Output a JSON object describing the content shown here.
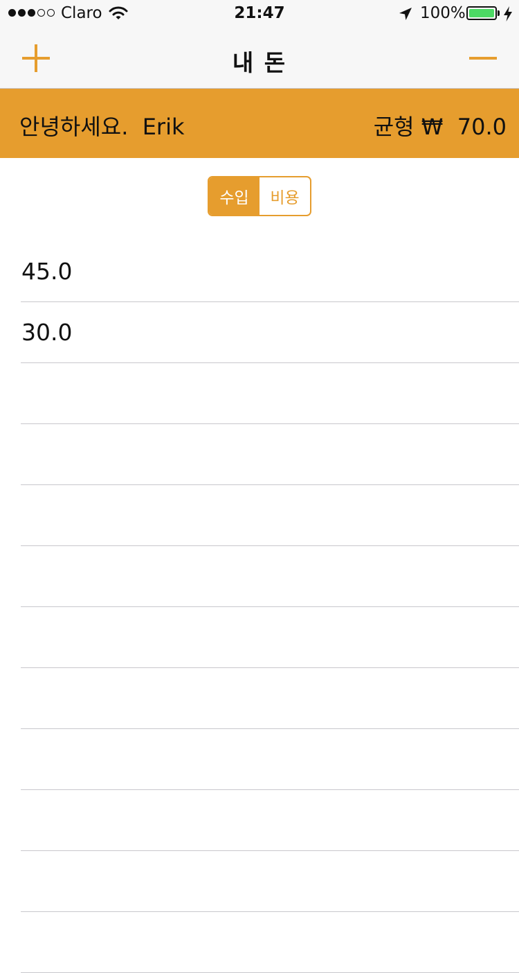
{
  "status_bar": {
    "signal_dots_filled": 3,
    "signal_dots_total": 5,
    "carrier": "Claro",
    "time": "21:47",
    "battery_percent_label": "100%",
    "battery_level": 1.0,
    "battery_color": "#4cd964",
    "icons": [
      "wifi-icon",
      "location-arrow-icon",
      "battery-icon",
      "charging-bolt-icon"
    ]
  },
  "nav": {
    "title": "내 돈",
    "left_icon": "plus-icon",
    "right_icon": "minus-icon"
  },
  "banner": {
    "greeting": "안녕하세요.  Erik",
    "balance": "균형 ₩  70.0"
  },
  "segmented_control": {
    "options": [
      "수입",
      "비용"
    ],
    "selected_index": 0
  },
  "entries": {
    "rows": [
      "45.0",
      "30.0",
      "",
      "",
      "",
      "",
      "",
      "",
      "",
      "",
      "",
      ""
    ]
  },
  "colors": {
    "accent": "#e69d2e",
    "bar_background": "#f7f7f7",
    "separator": "#c8c7cc"
  }
}
